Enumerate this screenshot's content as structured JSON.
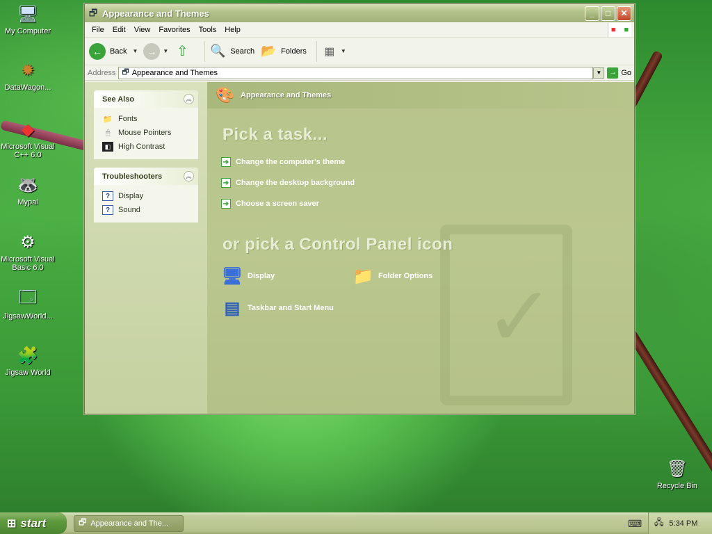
{
  "desktop_icons": [
    {
      "label": "My Computer",
      "icon": "computer-icon"
    },
    {
      "label": "DataWagon...",
      "icon": "datawagon-icon"
    },
    {
      "label": "Microsoft Visual C++ 6.0",
      "icon": "visual-cpp-icon"
    },
    {
      "label": "Mypal",
      "icon": "mypal-icon"
    },
    {
      "label": "Microsoft Visual Basic 6.0",
      "icon": "visual-basic-icon"
    },
    {
      "label": "JigsawWorld...",
      "icon": "jigsawworld-icon"
    },
    {
      "label": "Jigsaw World",
      "icon": "jigsaw-world-icon"
    },
    {
      "label": "Recycle Bin",
      "icon": "recycle-bin-icon"
    }
  ],
  "window": {
    "title": "Appearance and Themes",
    "menu": [
      "File",
      "Edit",
      "View",
      "Favorites",
      "Tools",
      "Help"
    ],
    "toolbar": {
      "back": "Back",
      "search": "Search",
      "folders": "Folders"
    },
    "address": {
      "label": "Address",
      "value": "Appearance and Themes",
      "go": "Go"
    }
  },
  "see_also": {
    "title": "See Also",
    "items": [
      {
        "label": "Fonts",
        "icon": "fonts-folder-icon"
      },
      {
        "label": "Mouse Pointers",
        "icon": "mouse-icon"
      },
      {
        "label": "High Contrast",
        "icon": "contrast-icon"
      }
    ]
  },
  "troubleshooters": {
    "title": "Troubleshooters",
    "items": [
      {
        "label": "Display",
        "icon": "help-icon"
      },
      {
        "label": "Sound",
        "icon": "help-icon"
      }
    ]
  },
  "main": {
    "category_title": "Appearance and Themes",
    "pick_task": "Pick a task...",
    "tasks": [
      "Change the computer's theme",
      "Change the desktop background",
      "Choose a screen saver"
    ],
    "pick_icon": "or pick a Control Panel icon",
    "icons": [
      {
        "label": "Display",
        "icon": "display-icon"
      },
      {
        "label": "Folder Options",
        "icon": "folder-options-icon"
      },
      {
        "label": "Taskbar and Start Menu",
        "icon": "taskbar-start-menu-icon"
      }
    ]
  },
  "taskbar": {
    "start": "start",
    "task_button": "Appearance and The...",
    "clock": "5:34 PM"
  }
}
